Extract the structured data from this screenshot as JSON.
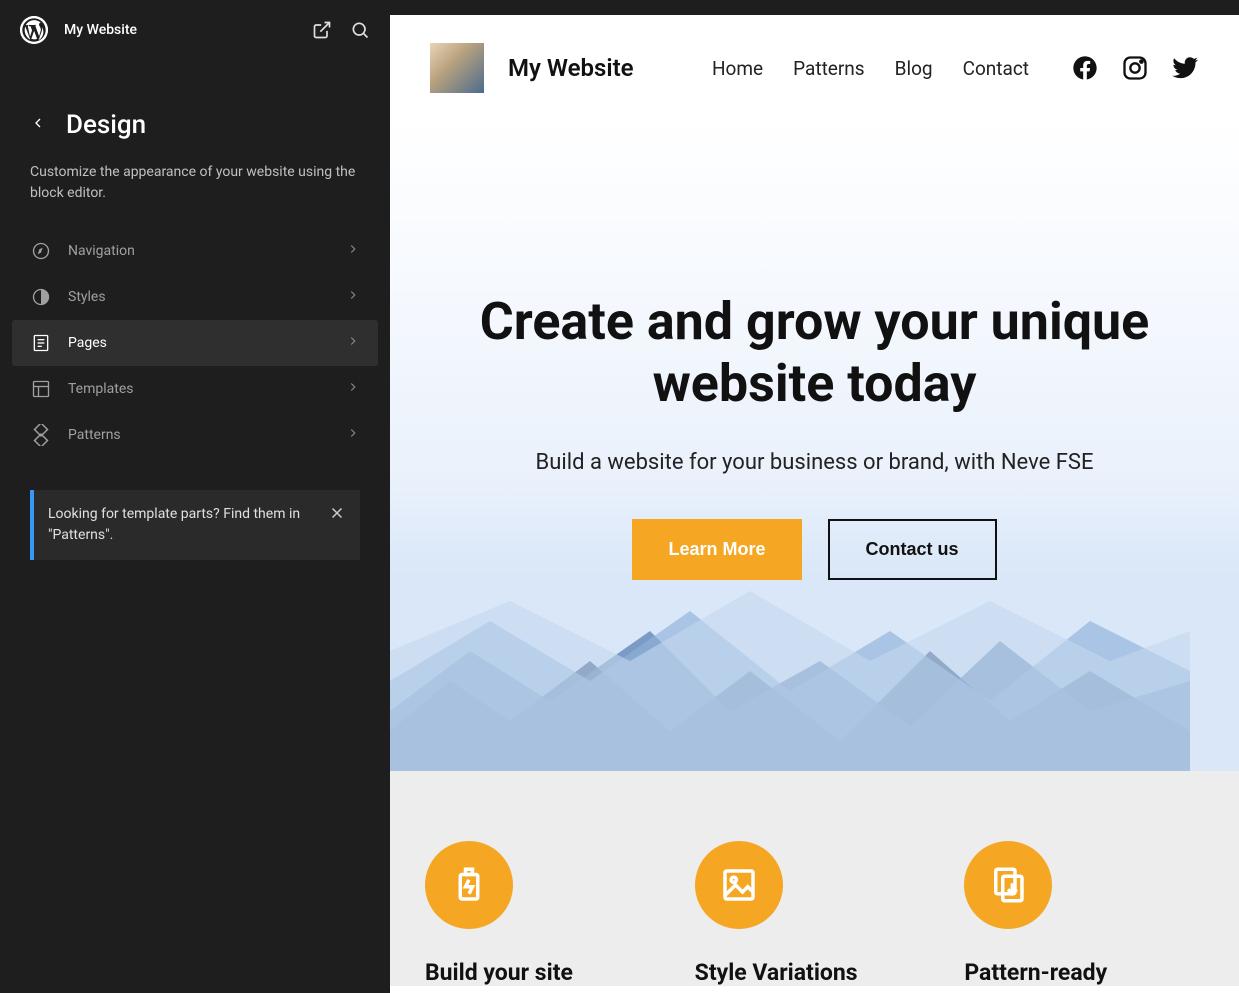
{
  "sidebar": {
    "site_name": "My Website",
    "section_title": "Design",
    "description": "Customize the appearance of your website using the block editor.",
    "nav": [
      {
        "label": "Navigation",
        "icon": "compass-icon",
        "active": false
      },
      {
        "label": "Styles",
        "icon": "contrast-icon",
        "active": false
      },
      {
        "label": "Pages",
        "icon": "page-icon",
        "active": true
      },
      {
        "label": "Templates",
        "icon": "layout-icon",
        "active": false
      },
      {
        "label": "Patterns",
        "icon": "diamond-icon",
        "active": false
      }
    ],
    "notice": "Looking for template parts? Find them in \"Patterns\"."
  },
  "preview": {
    "site_title": "My Website",
    "menu": [
      "Home",
      "Patterns",
      "Blog",
      "Contact"
    ],
    "hero": {
      "heading": "Create and grow your unique website today",
      "subtitle": "Build a website for your business or brand, with Neve FSE",
      "primary_btn": "Learn More",
      "secondary_btn": "Contact us"
    },
    "features": [
      {
        "title": "Build your site",
        "icon": "battery-icon"
      },
      {
        "title": "Style Variations",
        "icon": "image-icon"
      },
      {
        "title": "Pattern-ready",
        "icon": "copy-icon"
      }
    ]
  },
  "colors": {
    "accent": "#f5a623",
    "sidebar_bg": "#1e1e1e",
    "notice_border": "#3698f3"
  }
}
